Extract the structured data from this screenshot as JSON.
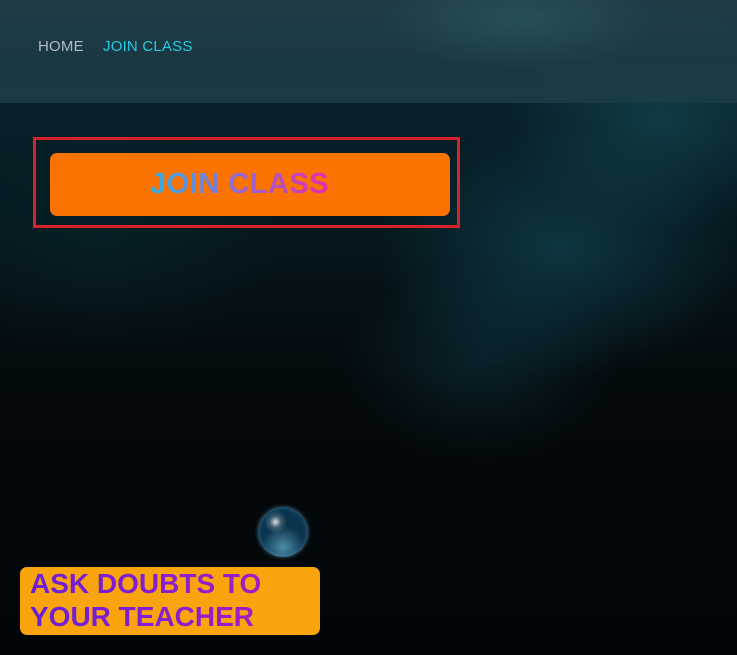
{
  "nav": {
    "home_label": "HOME",
    "join_label": "JOIN CLASS",
    "active_color": "#2ad3ee"
  },
  "main": {
    "join_button_label": "JOIN CLASS",
    "join_button_color": "#fa7200",
    "frame_color": "#d7222a"
  },
  "footer_card": {
    "line1": "ASK DOUBTS TO",
    "line2": "YOUR TEACHER",
    "color": "#f9a40c"
  },
  "decor": {
    "bubble_icon": "bubble-icon"
  }
}
